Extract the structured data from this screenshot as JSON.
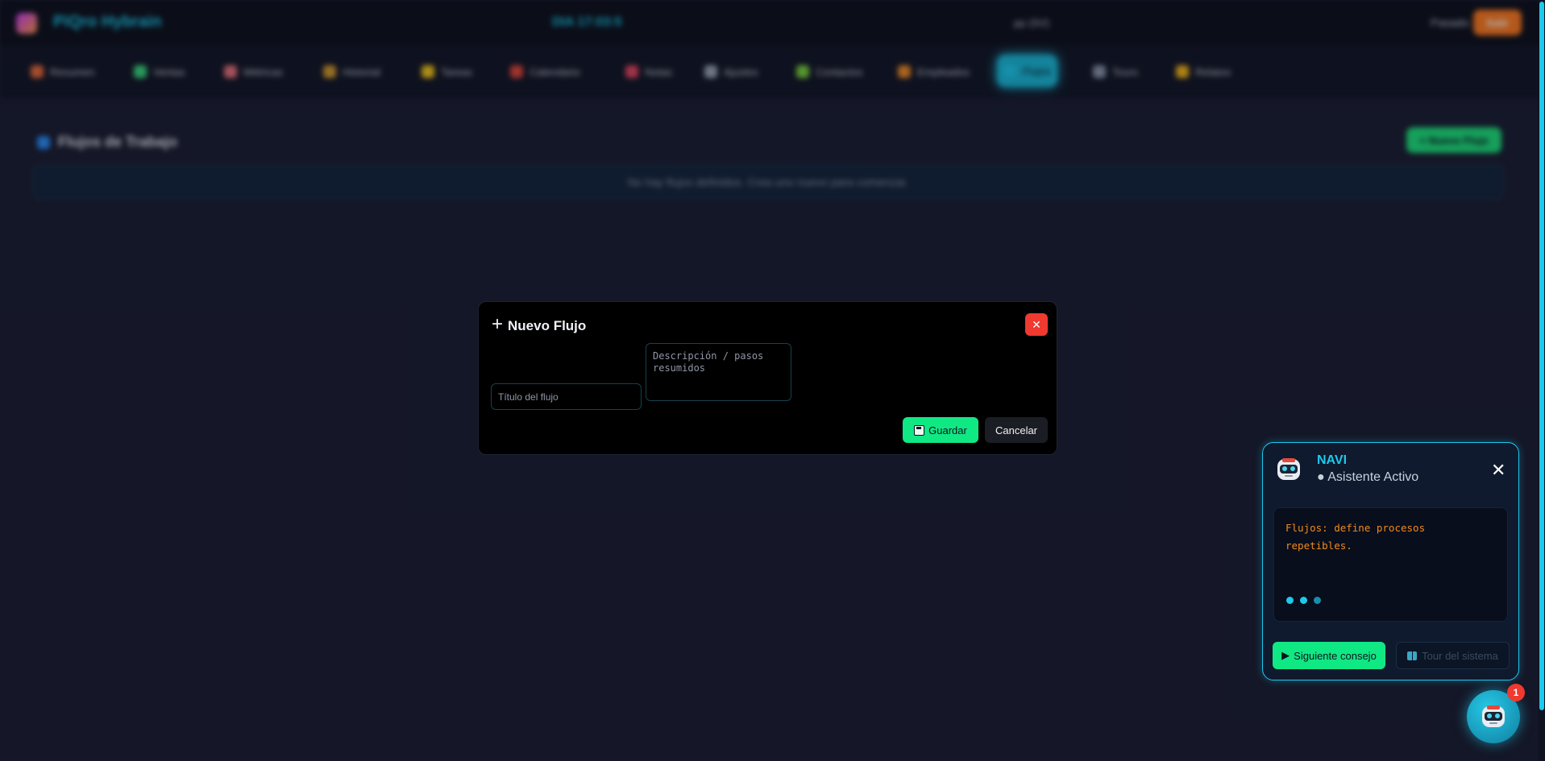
{
  "app": {
    "brand": "PiQro Hybrain",
    "top_center": "DIA 17:03:5",
    "top_user": "pp (SV)",
    "top_right_label": "Pasado",
    "top_right_button": "Salir"
  },
  "nav": {
    "items": [
      {
        "label": "Resumen",
        "color": "#e96a3a"
      },
      {
        "label": "Ventas",
        "color": "#3ad67a"
      },
      {
        "label": "Métricas",
        "color": "#e8727a"
      },
      {
        "label": "Historial",
        "color": "#d49a2a"
      },
      {
        "label": "Tareas",
        "color": "#f5c518"
      },
      {
        "label": "Calendario",
        "color": "#e0453a"
      },
      {
        "label": "Notas",
        "color": "#e2455e"
      },
      {
        "label": "Ajustes",
        "color": "#9aa4b5"
      },
      {
        "label": "Contactos",
        "color": "#7ad03a"
      },
      {
        "label": "Empleados",
        "color": "#f08a24"
      },
      {
        "label": "Flujos",
        "color": "#1ec9ec"
      },
      {
        "label": "Tours",
        "color": "#8a94a8"
      },
      {
        "label": "Relatos",
        "color": "#f5b418"
      }
    ]
  },
  "section": {
    "title": "Flujos de Trabajo",
    "new_button": "+ Nuevo Flujo",
    "empty_text": "No hay flujos definidos. Crea uno nuevo para comenzar."
  },
  "modal": {
    "title": "Nuevo Flujo",
    "title_placeholder": "Título del flujo",
    "description_placeholder": "Descripción / pasos resumidos",
    "save_label": "Guardar",
    "cancel_label": "Cancelar",
    "close_glyph": "✕"
  },
  "navi": {
    "name": "NAVI",
    "status": "● Asistente Activo",
    "close_glyph": "✕",
    "message": "Flujos: define procesos repetibles.",
    "next_tip_label": "Siguiente consejo",
    "tour_label": "Tour del sistema",
    "badge_count": "1"
  },
  "colors": {
    "accent": "#1ec9ec",
    "success": "#10e884",
    "danger": "#f0392f",
    "tip_text": "#f28a1e"
  }
}
